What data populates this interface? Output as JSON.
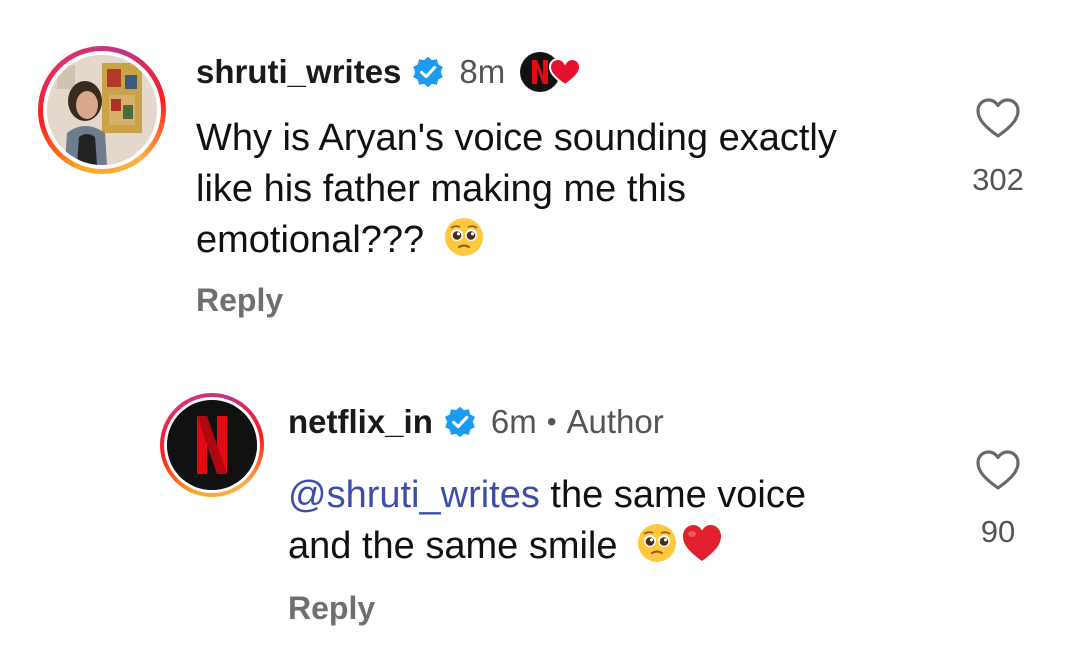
{
  "comments": [
    {
      "username": "shruti_writes",
      "time": "8m",
      "text": "Why is Aryan's voice sounding exactly like his father making me this emotional???",
      "text_lines": [
        "Why is Aryan's voice sounding exactly",
        "like his father making me this",
        "emotional???"
      ],
      "emoji_end": "pleading-face",
      "badge_after_time": "netflix-heart-badge",
      "reply_label": "Reply",
      "likes": "302"
    },
    {
      "username": "netflix_in",
      "time": "6m",
      "separator": "•",
      "author_label": "Author",
      "mention": "@shruti_writes",
      "text_line1_rest": " the same voice",
      "text_line2": "and the same smile",
      "emoji_end": [
        "pleading-face",
        "red-heart"
      ],
      "reply_label": "Reply",
      "likes": "90"
    }
  ],
  "colors": {
    "verified": "#1d9bf0",
    "mention": "#3b4fa8",
    "netflix_red": "#e50914",
    "muted": "#6f6f6f"
  }
}
